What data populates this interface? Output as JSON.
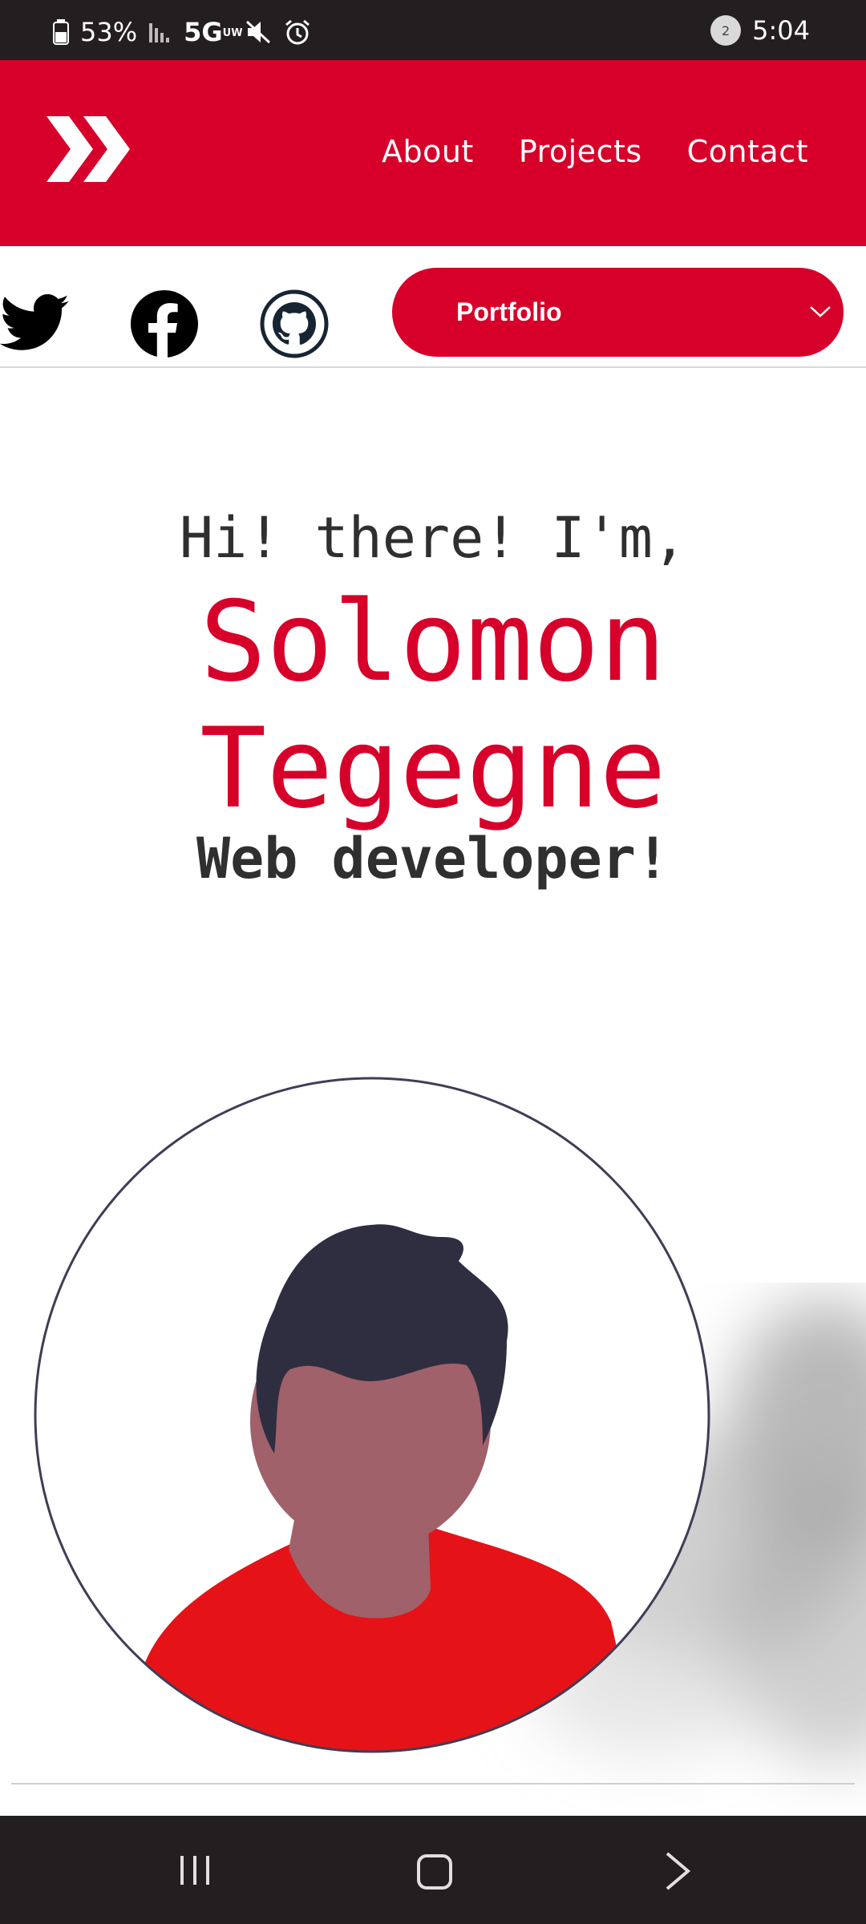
{
  "status_bar": {
    "battery": "53%",
    "network": "5G",
    "network_sub": "UW",
    "time": "5:04",
    "notif_badge": "2"
  },
  "header": {
    "logo_icon": "double-chevron-right-icon",
    "nav": [
      "About",
      "Projects",
      "Contact"
    ]
  },
  "social": {
    "icons": [
      "twitter-icon",
      "facebook-icon",
      "github-icon"
    ]
  },
  "dropdown": {
    "selected": "Portfolio"
  },
  "hero": {
    "greeting": "Hi! there! I'm,",
    "first_name": "Solomon",
    "last_name": "Tegegne",
    "role": "Web developer!"
  },
  "colors": {
    "brand": "#d7002a",
    "dark": "#231f20",
    "text": "#2f2f2f"
  }
}
